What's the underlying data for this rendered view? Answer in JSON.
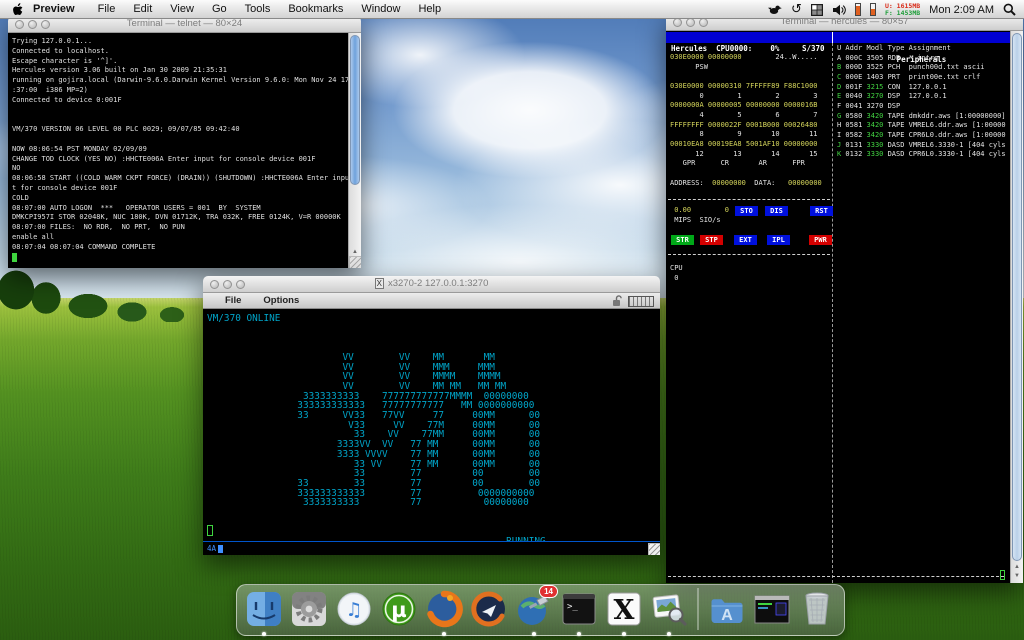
{
  "colors": {
    "x3270_cyan": "#00a4c8",
    "terminal_text": "#e0e0e0",
    "hercules_yellow": "#d6d65c",
    "hercules_green": "#42d442",
    "hercules_white": "#e4e4e4",
    "panel_blue": "#0000d2",
    "button_blue": "#0010dd",
    "button_green": "#00a818",
    "button_red": "#d40000",
    "mem_used": "#d92c1a",
    "mem_free": "#1f9e3a",
    "badge_red": "#e03030",
    "cursor_green": "#3fd43f",
    "oia_blue": "#4090ff"
  },
  "menu_bar": {
    "app_name": "Preview",
    "menus": [
      "File",
      "Edit",
      "View",
      "Go",
      "Tools",
      "Bookmarks",
      "Window",
      "Help"
    ],
    "status": {
      "mem_used": "U: 1615MB",
      "mem_free": "F: 1453MB",
      "clock": "Mon 2:09 AM"
    }
  },
  "telnet_window": {
    "title": "Terminal — telnet — 80×24",
    "lines": [
      "Trying 127.0.0.1...",
      "Connected to localhost.",
      "Escape character is '^]'.",
      "Hercules version 3.06 built on Jan 30 2009 21:35:31",
      "running on gojira.local (Darwin-9.6.0.Darwin Kernel Version 9.6.0: Mon Nov 24 17",
      ":37:00  i386 MP=2)",
      "Connected to device 0:001F",
      "",
      "",
      "VM/370 VERSION 06 LEVEL 00 PLC 0029; 09/07/85 09:42:40",
      "",
      "NOW 08:06:54 PST MONDAY 02/09/09",
      "CHANGE TOD CLOCK (YES NO) :HHCTE006A Enter input for console device 001F",
      "NO",
      "08:06:58 START ((COLD WARM CKPT FORCE) (DRAIN)) (SHUTDOWN) :HHCTE006A Enter inpu",
      "t for console device 001F",
      "COLD",
      "08:07:00 AUTO LOGON  ***   OPERATOR USERS = 001  BY  SYSTEM",
      "DMKCPI957I STOR 02048K, NUC 180K, DVN 01712K, TRA 032K, FREE 0124K, V=R 00000K",
      "08:07:00 FILES:  NO RDR,  NO PRT,  NO PUN",
      "enable all",
      "08:07:04 08:07:04 COMMAND COMPLETE"
    ]
  },
  "x3270_window": {
    "title": "x3270-2 127.0.0.1:3270",
    "menus": [
      "File",
      "Options"
    ],
    "oia_status": "4A",
    "screen_lines": [
      "VM/370 ONLINE",
      "",
      "",
      "",
      "                        VV        VV    MM       MM",
      "                        VV        VV    MMM     MMM",
      "                        VV        VV    MMMM    MMMM",
      "                        VV        VV    MM MM   MM MM",
      "                 3333333333    777777777777MMMM  00000000",
      "                333333333333   77777777777   MM 0000000000",
      "                33      VV33   77VV     77     00MM      00",
      "                         V33     VV    77M     00MM      00",
      "                          33    VV    77MM     00MM      00",
      "                       3333VV  VV   77 MM      00MM      00",
      "                       3333 VVVV    77 MM      00MM      00",
      "                          33 VV     77 MM      00MM      00",
      "                          33        77         00        00",
      "                33        33        77         00        00",
      "                333333333333        77          0000000000",
      "                 3333333333         77           00000000",
      "",
      "",
      "",
      "                                                     RUNNING"
    ]
  },
  "hercules_window": {
    "title": "Terminal — hercules — 80×57",
    "header_left": "Hercules  CPU0000:    0%     S/370",
    "header_right": "Peripherals",
    "registers_lines": [
      [
        [
          "y",
          "030E0000 00000000"
        ],
        [
          "w",
          "        24..W....."
        ]
      ],
      [
        [
          "w",
          "      PSW"
        ]
      ],
      [],
      [
        [
          "y",
          "030E0000 00000310 7FFFFF89 F88C1000"
        ]
      ],
      [
        [
          "w",
          "       0        1        2        3"
        ]
      ],
      [
        [
          "y",
          "0000000A 00000005 00000000 0000016B"
        ]
      ],
      [
        [
          "w",
          "       4        5        6        7"
        ]
      ],
      [
        [
          "y",
          "FFFFFFFF 0000022F 0001B000 00026480"
        ]
      ],
      [
        [
          "w",
          "       8        9       10       11"
        ]
      ],
      [
        [
          "y",
          "00010EA8 00019EA8 5001AF10 00000000"
        ]
      ],
      [
        [
          "w",
          "      12       13       14       15"
        ]
      ],
      [
        [
          "w",
          "   GPR      CR       AR      FPR"
        ]
      ],
      [],
      [
        [
          "w",
          "ADDRESS:  "
        ],
        [
          "y",
          "00000000"
        ],
        [
          "w",
          "  DATA:   "
        ],
        [
          "y",
          "00000000"
        ]
      ]
    ],
    "mips_lines": [
      [
        [
          "y",
          " 0.00        0"
        ]
      ],
      [
        [
          "w",
          " MIPS  SIO/s"
        ]
      ]
    ],
    "cpu_lines": [
      [
        [
          "w",
          "CPU"
        ]
      ],
      [
        [
          "w",
          " 0"
        ]
      ]
    ],
    "buttons_row1": [
      {
        "label": "STO",
        "color": "blue"
      },
      {
        "label": "DIS",
        "color": "blue"
      },
      {
        "label": "RST",
        "color": "blue"
      }
    ],
    "buttons_row2": [
      {
        "label": "STR",
        "color": "green"
      },
      {
        "label": "STP",
        "color": "red"
      },
      {
        "label": "EXT",
        "color": "blue"
      },
      {
        "label": "IPL",
        "color": "blue"
      },
      {
        "label": "PWR",
        "color": "red"
      }
    ],
    "peripherals_lines": [
      [
        [
          "w",
          "U Addr Modl Type Assignment"
        ]
      ],
      [
        [
          "w",
          "A 000C 3505 RDR  * intrq"
        ]
      ],
      [
        [
          "g",
          "B"
        ],
        [
          "w",
          " 000D 3525 PCH  punch00d.txt ascii"
        ]
      ],
      [
        [
          "g",
          "C"
        ],
        [
          "w",
          " 000E 1403 PRT  print00e.txt crlf"
        ]
      ],
      [
        [
          "g",
          "D"
        ],
        [
          "w",
          " 001F "
        ],
        [
          "g",
          "3215"
        ],
        [
          "w",
          " CON  127.0.0.1"
        ]
      ],
      [
        [
          "g",
          "E"
        ],
        [
          "w",
          " 0040 "
        ],
        [
          "g",
          "3270"
        ],
        [
          "w",
          " DSP  127.0.0.1"
        ]
      ],
      [
        [
          "w",
          "F 0041 3270 DSP"
        ]
      ],
      [
        [
          "g",
          "G"
        ],
        [
          "w",
          " 0580 "
        ],
        [
          "g",
          "3420"
        ],
        [
          "w",
          " TAPE dmkddr.aws [1:00000000]"
        ]
      ],
      [
        [
          "w",
          "H 0581 "
        ],
        [
          "g",
          "3420"
        ],
        [
          "w",
          " TAPE VMREL6.ddr.aws [1:00000"
        ]
      ],
      [
        [
          "w",
          "I 0582 "
        ],
        [
          "g",
          "3420"
        ],
        [
          "w",
          " TAPE CPR6L0.ddr.aws [1:00000"
        ]
      ],
      [
        [
          "g",
          "J"
        ],
        [
          "w",
          " 0131 "
        ],
        [
          "g",
          "3330"
        ],
        [
          "w",
          " DASD VMREL6.3330-1 [404 cyls"
        ]
      ],
      [
        [
          "g",
          "K"
        ],
        [
          "w",
          " 0132 "
        ],
        [
          "g",
          "3330"
        ],
        [
          "w",
          " DASD CPR6L0.3330-1 [404 cyls"
        ]
      ]
    ]
  },
  "dock": {
    "items": [
      {
        "icon": "finder",
        "running": true
      },
      {
        "icon": "system-preferences"
      },
      {
        "icon": "itunes"
      },
      {
        "icon": "utorrent"
      },
      {
        "icon": "firefox",
        "running": true
      },
      {
        "icon": "seamonkey"
      },
      {
        "icon": "satellite-app",
        "badge": "14",
        "running": true
      },
      {
        "icon": "terminal",
        "running": true
      },
      {
        "icon": "x11",
        "running": true
      },
      {
        "icon": "preview",
        "running": true
      },
      {
        "divider": true
      },
      {
        "icon": "applications-folder"
      },
      {
        "icon": "minimized-window"
      },
      {
        "icon": "trash"
      }
    ]
  }
}
